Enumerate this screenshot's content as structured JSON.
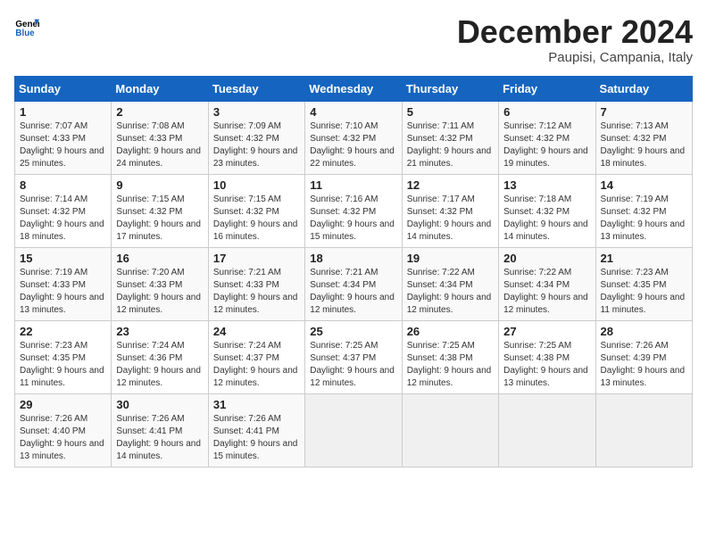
{
  "logo": {
    "line1": "General",
    "line2": "Blue"
  },
  "title": "December 2024",
  "subtitle": "Paupisi, Campania, Italy",
  "weekdays": [
    "Sunday",
    "Monday",
    "Tuesday",
    "Wednesday",
    "Thursday",
    "Friday",
    "Saturday"
  ],
  "weeks": [
    [
      {
        "day": "1",
        "rise": "7:07 AM",
        "set": "4:33 PM",
        "daylight": "9 hours and 25 minutes."
      },
      {
        "day": "2",
        "rise": "7:08 AM",
        "set": "4:33 PM",
        "daylight": "9 hours and 24 minutes."
      },
      {
        "day": "3",
        "rise": "7:09 AM",
        "set": "4:32 PM",
        "daylight": "9 hours and 23 minutes."
      },
      {
        "day": "4",
        "rise": "7:10 AM",
        "set": "4:32 PM",
        "daylight": "9 hours and 22 minutes."
      },
      {
        "day": "5",
        "rise": "7:11 AM",
        "set": "4:32 PM",
        "daylight": "9 hours and 21 minutes."
      },
      {
        "day": "6",
        "rise": "7:12 AM",
        "set": "4:32 PM",
        "daylight": "9 hours and 19 minutes."
      },
      {
        "day": "7",
        "rise": "7:13 AM",
        "set": "4:32 PM",
        "daylight": "9 hours and 18 minutes."
      }
    ],
    [
      {
        "day": "8",
        "rise": "7:14 AM",
        "set": "4:32 PM",
        "daylight": "9 hours and 18 minutes."
      },
      {
        "day": "9",
        "rise": "7:15 AM",
        "set": "4:32 PM",
        "daylight": "9 hours and 17 minutes."
      },
      {
        "day": "10",
        "rise": "7:15 AM",
        "set": "4:32 PM",
        "daylight": "9 hours and 16 minutes."
      },
      {
        "day": "11",
        "rise": "7:16 AM",
        "set": "4:32 PM",
        "daylight": "9 hours and 15 minutes."
      },
      {
        "day": "12",
        "rise": "7:17 AM",
        "set": "4:32 PM",
        "daylight": "9 hours and 14 minutes."
      },
      {
        "day": "13",
        "rise": "7:18 AM",
        "set": "4:32 PM",
        "daylight": "9 hours and 14 minutes."
      },
      {
        "day": "14",
        "rise": "7:19 AM",
        "set": "4:32 PM",
        "daylight": "9 hours and 13 minutes."
      }
    ],
    [
      {
        "day": "15",
        "rise": "7:19 AM",
        "set": "4:33 PM",
        "daylight": "9 hours and 13 minutes."
      },
      {
        "day": "16",
        "rise": "7:20 AM",
        "set": "4:33 PM",
        "daylight": "9 hours and 12 minutes."
      },
      {
        "day": "17",
        "rise": "7:21 AM",
        "set": "4:33 PM",
        "daylight": "9 hours and 12 minutes."
      },
      {
        "day": "18",
        "rise": "7:21 AM",
        "set": "4:34 PM",
        "daylight": "9 hours and 12 minutes."
      },
      {
        "day": "19",
        "rise": "7:22 AM",
        "set": "4:34 PM",
        "daylight": "9 hours and 12 minutes."
      },
      {
        "day": "20",
        "rise": "7:22 AM",
        "set": "4:34 PM",
        "daylight": "9 hours and 12 minutes."
      },
      {
        "day": "21",
        "rise": "7:23 AM",
        "set": "4:35 PM",
        "daylight": "9 hours and 11 minutes."
      }
    ],
    [
      {
        "day": "22",
        "rise": "7:23 AM",
        "set": "4:35 PM",
        "daylight": "9 hours and 11 minutes."
      },
      {
        "day": "23",
        "rise": "7:24 AM",
        "set": "4:36 PM",
        "daylight": "9 hours and 12 minutes."
      },
      {
        "day": "24",
        "rise": "7:24 AM",
        "set": "4:37 PM",
        "daylight": "9 hours and 12 minutes."
      },
      {
        "day": "25",
        "rise": "7:25 AM",
        "set": "4:37 PM",
        "daylight": "9 hours and 12 minutes."
      },
      {
        "day": "26",
        "rise": "7:25 AM",
        "set": "4:38 PM",
        "daylight": "9 hours and 12 minutes."
      },
      {
        "day": "27",
        "rise": "7:25 AM",
        "set": "4:38 PM",
        "daylight": "9 hours and 13 minutes."
      },
      {
        "day": "28",
        "rise": "7:26 AM",
        "set": "4:39 PM",
        "daylight": "9 hours and 13 minutes."
      }
    ],
    [
      {
        "day": "29",
        "rise": "7:26 AM",
        "set": "4:40 PM",
        "daylight": "9 hours and 13 minutes."
      },
      {
        "day": "30",
        "rise": "7:26 AM",
        "set": "4:41 PM",
        "daylight": "9 hours and 14 minutes."
      },
      {
        "day": "31",
        "rise": "7:26 AM",
        "set": "4:41 PM",
        "daylight": "9 hours and 15 minutes."
      },
      null,
      null,
      null,
      null
    ]
  ]
}
